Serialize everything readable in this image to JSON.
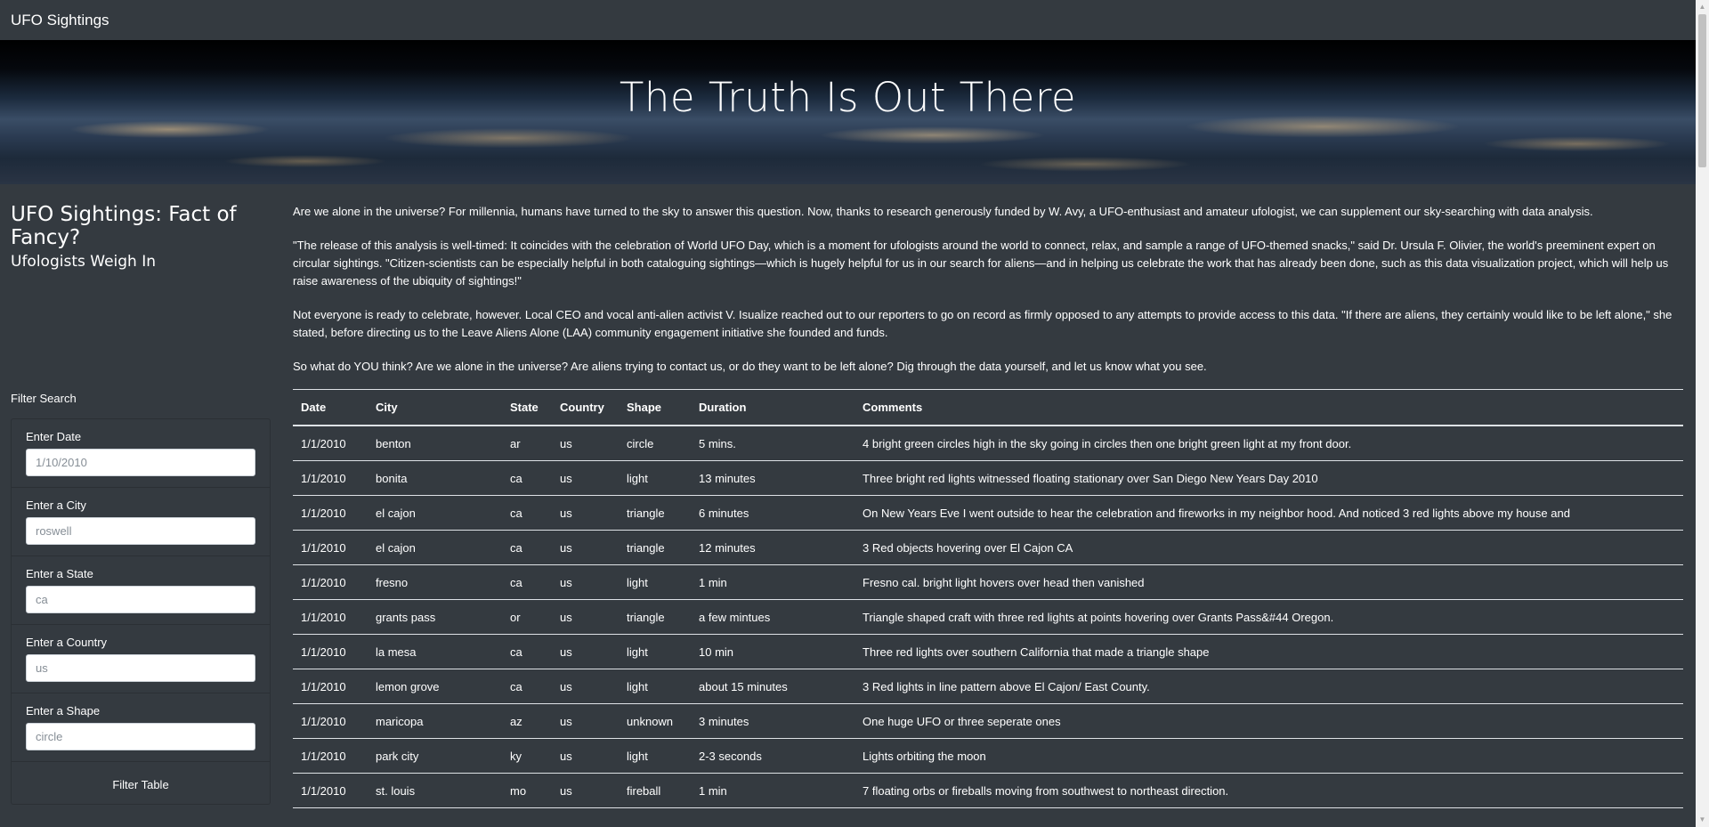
{
  "navbar": {
    "brand": "UFO Sightings"
  },
  "hero": {
    "title": "The Truth Is Out There"
  },
  "sidebar": {
    "title": "UFO Sightings: Fact of Fancy?",
    "subtitle": "Ufologists Weigh In"
  },
  "filters": {
    "heading": "Filter Search",
    "fields": [
      {
        "label": "Enter Date",
        "placeholder": "1/10/2010"
      },
      {
        "label": "Enter a City",
        "placeholder": "roswell"
      },
      {
        "label": "Enter a State",
        "placeholder": "ca"
      },
      {
        "label": "Enter a Country",
        "placeholder": "us"
      },
      {
        "label": "Enter a Shape",
        "placeholder": "circle"
      }
    ],
    "button": "Filter Table"
  },
  "article": {
    "paragraphs": [
      "Are we alone in the universe? For millennia, humans have turned to the sky to answer this question. Now, thanks to research generously funded by W. Avy, a UFO-enthusiast and amateur ufologist, we can supplement our sky-searching with data analysis.",
      "\"The release of this analysis is well-timed: It coincides with the celebration of World UFO Day, which is a moment for ufologists around the world to connect, relax, and sample a range of UFO-themed snacks,\" said Dr. Ursula F. Olivier, the world's preeminent expert on circular sightings. \"Citizen-scientists can be especially helpful in both cataloguing sightings—which is hugely helpful for us in our search for aliens—and in helping us celebrate the work that has already been done, such as this data visualization project, which will help us raise awareness of the ubiquity of sightings!\"",
      "Not everyone is ready to celebrate, however. Local CEO and vocal anti-alien activist V. Isualize reached out to our reporters to go on record as firmly opposed to any attempts to provide access to this data. \"If there are aliens, they certainly would like to be left alone,\" she stated, before directing us to the Leave Aliens Alone (LAA) community engagement initiative she founded and funds.",
      "So what do YOU think? Are we alone in the universe? Are aliens trying to contact us, or do they want to be left alone? Dig through the data yourself, and let us know what you see."
    ]
  },
  "table": {
    "columns": [
      "Date",
      "City",
      "State",
      "Country",
      "Shape",
      "Duration",
      "Comments"
    ],
    "rows": [
      [
        "1/1/2010",
        "benton",
        "ar",
        "us",
        "circle",
        "5 mins.",
        "4 bright green circles high in the sky going in circles then one bright green light at my front door."
      ],
      [
        "1/1/2010",
        "bonita",
        "ca",
        "us",
        "light",
        "13 minutes",
        "Three bright red lights witnessed floating stationary over San Diego New Years Day 2010"
      ],
      [
        "1/1/2010",
        "el cajon",
        "ca",
        "us",
        "triangle",
        "6 minutes",
        "On New Years Eve I went outside to hear the celebration and fireworks in my neighbor hood. And noticed 3 red lights above my house and"
      ],
      [
        "1/1/2010",
        "el cajon",
        "ca",
        "us",
        "triangle",
        "12 minutes",
        "3 Red objects hovering over El Cajon CA"
      ],
      [
        "1/1/2010",
        "fresno",
        "ca",
        "us",
        "light",
        "1 min",
        "Fresno cal. bright light hovers over head then vanished"
      ],
      [
        "1/1/2010",
        "grants pass",
        "or",
        "us",
        "triangle",
        "a few mintues",
        "Triangle shaped craft with three red lights at points hovering over Grants Pass&#44 Oregon."
      ],
      [
        "1/1/2010",
        "la mesa",
        "ca",
        "us",
        "light",
        "10 min",
        "Three red lights over southern California that made a triangle shape"
      ],
      [
        "1/1/2010",
        "lemon grove",
        "ca",
        "us",
        "light",
        "about 15 minutes",
        "3 Red lights in line pattern above El Cajon/ East County."
      ],
      [
        "1/1/2010",
        "maricopa",
        "az",
        "us",
        "unknown",
        "3 minutes",
        "One huge UFO or three seperate ones"
      ],
      [
        "1/1/2010",
        "park city",
        "ky",
        "us",
        "light",
        "2-3 seconds",
        "Lights orbiting the moon"
      ],
      [
        "1/1/2010",
        "st. louis",
        "mo",
        "us",
        "fireball",
        "1 min",
        "7 floating orbs or fireballs moving from southwest to northeast direction."
      ]
    ]
  }
}
